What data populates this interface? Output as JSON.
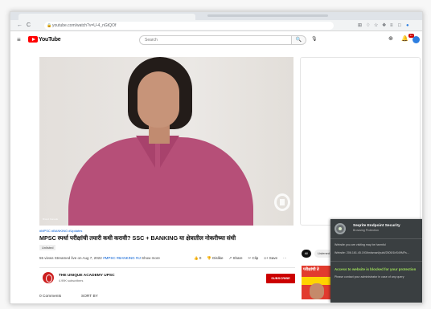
{
  "browser": {
    "url": "youtube.com/watch?v=U-4_nGtQOf",
    "nav_back": "←",
    "nav_reload": "C",
    "lock": "🔒",
    "extension_icons": [
      "⊞",
      "♢",
      "☆",
      "❖",
      "≡",
      "□",
      "●"
    ]
  },
  "header": {
    "menu": "≡",
    "logo_text": "YouTube",
    "search_placeholder": "Search",
    "search_button": "🔍",
    "mic": "🎙",
    "create_icon": "⊕",
    "notif_icon": "🔔",
    "notif_count": "9+"
  },
  "video": {
    "watermark_caption": "Brand Kanade"
  },
  "meta": {
    "hashtags_top": "#MPSC #BANKING #Updates",
    "title": "MPSC स्पर्धा परीक्षांची तयारी कधी करावी? SSC + BANKING या क्षेत्रातील नोकरीच्या संधी",
    "unlisted": "Unlisted",
    "desc_stats": "55 views  Streamed live on Aug 7, 2022",
    "desc_tags": "#MPSC #BANKING #IJ",
    "show_more": "Show more",
    "actions": [
      "👍 0",
      "👎 Dislike",
      "↗ Share",
      "✂ Clip",
      "≡+ Save",
      "···"
    ],
    "channel_name": "THE UNIQUE ACADEMY UPSC",
    "subscribers": "4.99K subscribers",
    "subscribe": "SUBSCRIBE",
    "comments": "0 Comments",
    "sort_by": "SORT BY"
  },
  "sidebar": {
    "chip_all": "All",
    "chip_listened": "Listened",
    "thumb_text": "परीक्षांची ते"
  },
  "popup": {
    "title": "Seqrite Endpoint Security",
    "subtitle": "Browsing Protection",
    "line1": "Website you are visiting may be harmful",
    "line2": "Website: 206.161.45.193/bnlsmart/publ/2505/1bS49MFs...",
    "blocked": "Access to website is blocked for your protection",
    "contact": "Please contact your administrator in case of any query"
  }
}
